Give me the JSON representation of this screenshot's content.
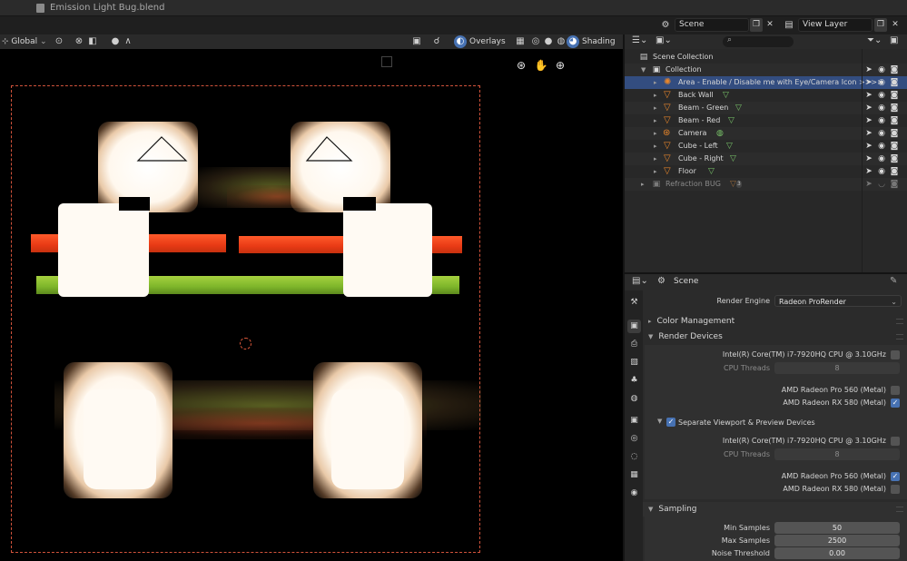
{
  "window": {
    "title": "Emission Light Bug.blend"
  },
  "topbar": {
    "scene": "Scene",
    "view_layer": "View Layer"
  },
  "viewport_header": {
    "orientation": "Global",
    "overlays_label": "Overlays",
    "shading_label": "Shading"
  },
  "outliner": {
    "root": "Scene Collection",
    "collection": "Collection",
    "items": [
      {
        "label": "Area - Enable / Disable me with Eye/Camera Icon >>>>",
        "icon": "area-light-icon",
        "data_icon": "",
        "active": true
      },
      {
        "label": "Back Wall",
        "icon": "mesh-object-icon",
        "data_icon": "mesh-data-icon"
      },
      {
        "label": "Beam - Green",
        "icon": "mesh-object-icon",
        "data_icon": "mesh-data-icon"
      },
      {
        "label": "Beam - Red",
        "icon": "mesh-object-icon",
        "data_icon": "mesh-data-icon"
      },
      {
        "label": "Camera",
        "icon": "camera-object-icon",
        "data_icon": "camera-data-icon"
      },
      {
        "label": "Cube - Left",
        "icon": "mesh-object-icon",
        "data_icon": "mesh-data-icon"
      },
      {
        "label": "Cube - Right",
        "icon": "mesh-object-icon",
        "data_icon": "mesh-data-icon"
      },
      {
        "label": "Floor",
        "icon": "mesh-object-icon",
        "data_icon": "mesh-data-icon"
      }
    ],
    "excluded": {
      "label": "Refraction BUG",
      "badge": "3"
    }
  },
  "properties": {
    "context": "Scene",
    "render_engine_label": "Render Engine",
    "render_engine_value": "Radeon ProRender",
    "color_management": "Color Management",
    "render_devices": "Render Devices",
    "cpu_name": "Intel(R) Core(TM) i7-7920HQ CPU @ 3.10GHz",
    "cpu_threads_label": "CPU Threads",
    "cpu_threads_value": "8",
    "gpu1": "AMD Radeon Pro 560 (Metal)",
    "gpu2": "AMD Radeon RX 580 (Metal)",
    "separate_label": "Separate Viewport & Preview Devices",
    "cpu_name_2": "Intel(R) Core(TM) i7-7920HQ CPU @ 3.10GHz",
    "cpu_threads_label_2": "CPU Threads",
    "cpu_threads_value_2": "8",
    "gpu1_b": "AMD Radeon Pro 560 (Metal)",
    "gpu2_b": "AMD Radeon RX 580 (Metal)",
    "sampling": "Sampling",
    "min_samples_label": "Min Samples",
    "min_samples_value": "50",
    "max_samples_label": "Max Samples",
    "max_samples_value": "2500",
    "noise_threshold_label": "Noise Threshold",
    "noise_threshold_value": "0.00"
  }
}
